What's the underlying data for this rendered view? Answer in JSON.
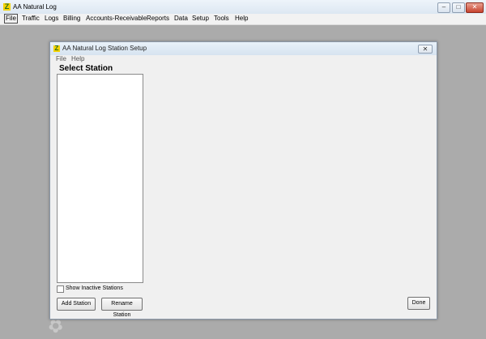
{
  "app": {
    "title": "AA Natural Log",
    "icon": "app-logo-icon",
    "controls": {
      "minimize": "–",
      "maximize": "□",
      "close": "✕"
    }
  },
  "menubar": [
    {
      "label": "File",
      "active": true
    },
    {
      "label": "Traffic"
    },
    {
      "label": "Logs"
    },
    {
      "label": "Billing"
    },
    {
      "label": "Accounts-Receivable"
    },
    {
      "label": "Reports"
    },
    {
      "label": "Data"
    },
    {
      "label": "Setup"
    },
    {
      "label": "Tools"
    },
    {
      "label": "Help"
    }
  ],
  "dialog": {
    "title": "AA Natural Log Station Setup",
    "close": "✕",
    "menu": [
      "File",
      "Help"
    ],
    "heading": "Select Station",
    "stations": [],
    "show_inactive": {
      "label": "Show Inactive Stations",
      "checked": false
    },
    "buttons": {
      "add": "Add Station",
      "rename": "Rename Station",
      "done": "Done"
    }
  },
  "colors": {
    "desktop": "#ababab",
    "dialog_bg": "#f0f0f0",
    "titlebar": "#dce7f2"
  }
}
